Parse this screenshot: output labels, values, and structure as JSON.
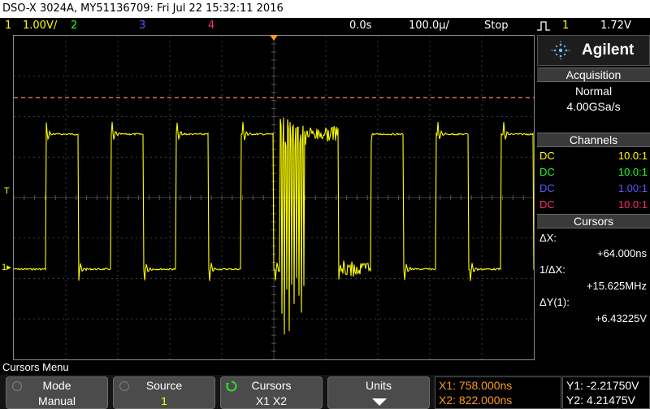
{
  "title_bar": {
    "text": "DSO-X 3024A, MY51136709: Fri Jul 22 15:32:11 2016"
  },
  "status_bar": {
    "ch1_num": "1",
    "ch1_scale": "1.00V/",
    "ch2_num": "2",
    "ch3_num": "3",
    "ch4_num": "4",
    "time_offset": "0.0s",
    "time_scale": "100.0µ/",
    "run_state": "Stop",
    "trigger_icon": "rising-edge-icon",
    "trigger_source": "1",
    "trigger_level": "1.72V"
  },
  "colors": {
    "ch1": "#ffff00",
    "ch2": "#22ff22",
    "ch3": "#5a5aff",
    "ch4": "#ff2a6a",
    "cursor": "#ff8a5a",
    "marker": "#ff9a1a"
  },
  "screen_markers": {
    "trigger_marker": "T",
    "ch1_ground_marker": "1"
  },
  "waveform": {
    "channel": "1",
    "description": "Square wave, 64 ns period, approx -2.2 V to 4.2 V, with ringing burst near center"
  },
  "panel": {
    "brand": "Agilent",
    "acquisition": {
      "heading": "Acquisition",
      "mode": "Normal",
      "rate": "4.00GSa/s"
    },
    "channels": {
      "heading": "Channels",
      "rows": [
        {
          "coupling": "DC",
          "probe": "10.0:1"
        },
        {
          "coupling": "DC",
          "probe": "10.0:1"
        },
        {
          "coupling": "DC",
          "probe": "1.00:1"
        },
        {
          "coupling": "DC",
          "probe": "10.0:1"
        }
      ]
    },
    "cursors": {
      "heading": "Cursors",
      "dx_label": "ΔX:",
      "dx_value": "+64.000ns",
      "inv_dx_label": "1/ΔX:",
      "inv_dx_value": "+15.625MHz",
      "dy_label": "ΔY(1):",
      "dy_value": "+6.43225V"
    }
  },
  "menu": {
    "title": "Cursors Menu",
    "softkeys": [
      {
        "title": "Mode",
        "value": "Manual"
      },
      {
        "title": "Source",
        "value": "1"
      },
      {
        "title": "Cursors",
        "value": "X1 X2"
      },
      {
        "title": "Units",
        "value": ""
      }
    ],
    "readouts": {
      "x1": "X1: 758.000ns",
      "x2": "X2: 822.000ns",
      "y1": "Y1: -2.21750V",
      "y2": "Y2: 4.21475V"
    }
  }
}
